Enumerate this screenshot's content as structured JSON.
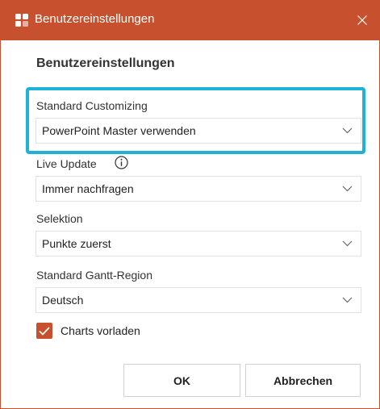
{
  "window": {
    "title": "Benutzereinstellungen",
    "accent_color": "#c7502e",
    "highlight_color": "#1fb2d6"
  },
  "heading": "Benutzereinstellungen",
  "fields": [
    {
      "label": "Standard Customizing",
      "value": "PowerPoint Master verwenden"
    },
    {
      "label": "Live Update",
      "value": "Immer nachfragen"
    },
    {
      "label": "Selektion",
      "value": "Punkte zuerst"
    },
    {
      "label": "Standard Gantt-Region",
      "value": "Deutsch"
    }
  ],
  "checkbox": {
    "label": "Charts vorladen",
    "checked": true
  },
  "buttons": {
    "ok": "OK",
    "cancel": "Abbrechen"
  }
}
